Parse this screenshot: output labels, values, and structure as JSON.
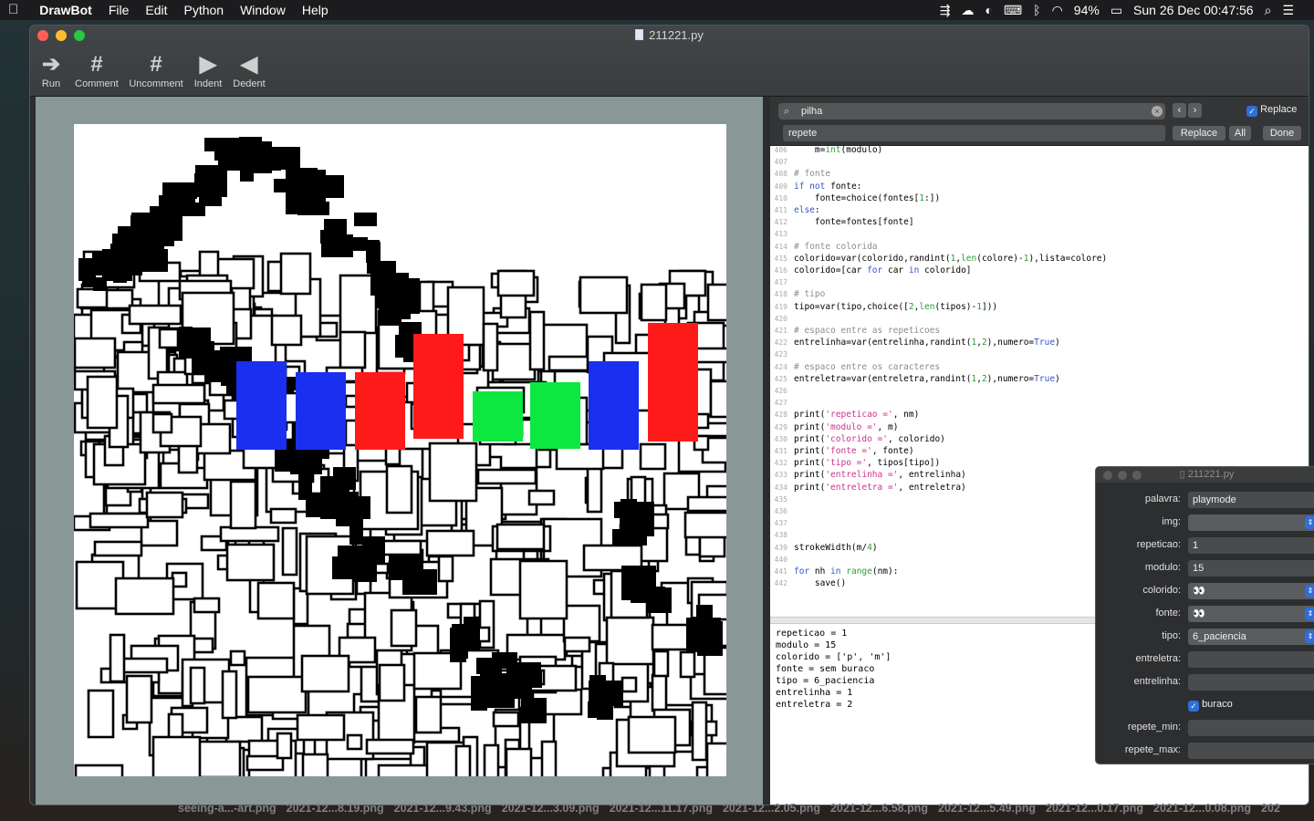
{
  "menubar": {
    "app": "DrawBot",
    "items": [
      "File",
      "Edit",
      "Python",
      "Window",
      "Help"
    ],
    "battery": "94%",
    "clock": "Sun 26 Dec  00:47:56"
  },
  "window": {
    "title": "211221.py",
    "toolbar": [
      {
        "label": "Run",
        "icon": "run-arrow-icon"
      },
      {
        "label": "Comment",
        "icon": "hash-icon"
      },
      {
        "label": "Uncomment",
        "icon": "hash-slash-icon"
      },
      {
        "label": "Indent",
        "icon": "triangle-right-icon"
      },
      {
        "label": "Dedent",
        "icon": "triangle-left-icon"
      }
    ]
  },
  "find": {
    "search": "pilha",
    "replace": "repete",
    "replace_checkbox_label": "Replace",
    "replace_checked": true,
    "btn_replace": "Replace",
    "btn_all": "All",
    "btn_done": "Done"
  },
  "code": [
    {
      "n": "406",
      "t": "    m=int(modulo)"
    },
    {
      "n": "407",
      "t": ""
    },
    {
      "n": "408",
      "t": "# fonte"
    },
    {
      "n": "409",
      "t": "if not fonte:"
    },
    {
      "n": "410",
      "t": "    fonte=choice(fontes[1:])"
    },
    {
      "n": "411",
      "t": "else:"
    },
    {
      "n": "412",
      "t": "    fonte=fontes[fonte]"
    },
    {
      "n": "413",
      "t": ""
    },
    {
      "n": "414",
      "t": "# fonte colorida"
    },
    {
      "n": "415",
      "t": "colorido=var(colorido,randint(1,len(colore)-1),lista=colore)"
    },
    {
      "n": "416",
      "t": "colorido=[car for car in colorido]"
    },
    {
      "n": "417",
      "t": ""
    },
    {
      "n": "418",
      "t": "# tipo"
    },
    {
      "n": "419",
      "t": "tipo=var(tipo,choice([2,len(tipos)-1]))"
    },
    {
      "n": "420",
      "t": ""
    },
    {
      "n": "421",
      "t": "# espaco entre as repeticoes"
    },
    {
      "n": "422",
      "t": "entrelinha=var(entrelinha,randint(1,2),numero=True)"
    },
    {
      "n": "423",
      "t": ""
    },
    {
      "n": "424",
      "t": "# espaco entre os caracteres"
    },
    {
      "n": "425",
      "t": "entreletra=var(entreletra,randint(1,2),numero=True)"
    },
    {
      "n": "426",
      "t": ""
    },
    {
      "n": "427",
      "t": ""
    },
    {
      "n": "428",
      "t": "print('repeticao =', nm)"
    },
    {
      "n": "429",
      "t": "print('modulo =', m)"
    },
    {
      "n": "430",
      "t": "print('colorido =', colorido)"
    },
    {
      "n": "431",
      "t": "print('fonte =', fonte)"
    },
    {
      "n": "432",
      "t": "print('tipo =', tipos[tipo])"
    },
    {
      "n": "433",
      "t": "print('entrelinha =', entrelinha)"
    },
    {
      "n": "434",
      "t": "print('entreletra =', entreletra)"
    },
    {
      "n": "435",
      "t": ""
    },
    {
      "n": "436",
      "t": ""
    },
    {
      "n": "437",
      "t": ""
    },
    {
      "n": "438",
      "t": ""
    },
    {
      "n": "439",
      "t": "strokeWidth(m/4)"
    },
    {
      "n": "440",
      "t": ""
    },
    {
      "n": "441",
      "t": "for nh in range(nm):"
    },
    {
      "n": "442",
      "t": "    save()"
    }
  ],
  "output": "repeticao = 1\nmodulo = 15\ncolorido = ['p', 'm']\nfonte = sem buraco\ntipo = 6_paciencia\nentrelinha = 1\nentreletra = 2",
  "vars": {
    "title": "211221.py",
    "rows": [
      {
        "label": "palavra:",
        "value": "playmode",
        "kind": "text"
      },
      {
        "label": "img:",
        "value": "",
        "kind": "popup"
      },
      {
        "label": "repeticao:",
        "value": "1",
        "kind": "text"
      },
      {
        "label": "modulo:",
        "value": "15",
        "kind": "text"
      },
      {
        "label": "colorido:",
        "value": "👀",
        "kind": "popup"
      },
      {
        "label": "fonte:",
        "value": "👀",
        "kind": "popup"
      },
      {
        "label": "tipo:",
        "value": "6_paciencia",
        "kind": "popup"
      },
      {
        "label": "entreletra:",
        "value": "",
        "kind": "text"
      },
      {
        "label": "entrelinha:",
        "value": "",
        "kind": "text"
      },
      {
        "label": "",
        "value": "buraco",
        "kind": "check"
      },
      {
        "label": "repete_min:",
        "value": "",
        "kind": "text"
      },
      {
        "label": "repete_max:",
        "value": "",
        "kind": "text"
      }
    ]
  },
  "files": [
    "seeing-a...-art.png",
    "2021-12...8.19.png",
    "2021-12...9.43.png",
    "2021-12...3.09.png",
    "2021-12...11.17.png",
    "2021-12...2.05.png",
    "2021-12...6.58.png",
    "2021-12...5.49.png",
    "2021-12...0.17.png",
    "2021-12...0.08.png",
    "202"
  ],
  "colors": {
    "blue": "#1a2ff0",
    "red": "#ff1a1a",
    "green": "#0de840",
    "black": "#000000"
  }
}
